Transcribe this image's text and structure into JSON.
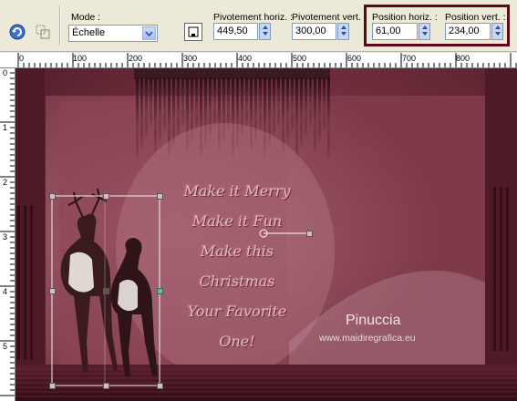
{
  "toolbar": {
    "mode_label": "Mode :",
    "mode_value": "Échelle",
    "pivot_h_label": "Pivotement horiz. :",
    "pivot_h_value": "449,50",
    "pivot_v_label": "Pivotement vert. :",
    "pivot_v_value": "300,00",
    "pos_h_label": "Position horiz. :",
    "pos_h_value": "61,00",
    "pos_v_label": "Position vert. :",
    "pos_v_value": "234,00"
  },
  "ruler_h": [
    "0",
    "100",
    "200",
    "300",
    "400",
    "500",
    "600",
    "700",
    "800"
  ],
  "ruler_v": [
    "0",
    "1",
    "2",
    "3",
    "4",
    "5"
  ],
  "canvas": {
    "poem_lines": [
      "Make it Merry",
      "Make it Fun",
      "Make this",
      "Christmas",
      "Your Favorite",
      "One!"
    ],
    "watermark_name": "Pinuccia",
    "watermark_url": "www.maidiregrafica.eu"
  },
  "colors": {
    "highlight": "#5c0a1a",
    "canvas_bg": "#6e2c3a",
    "poem_text": "#e6b7c0"
  }
}
